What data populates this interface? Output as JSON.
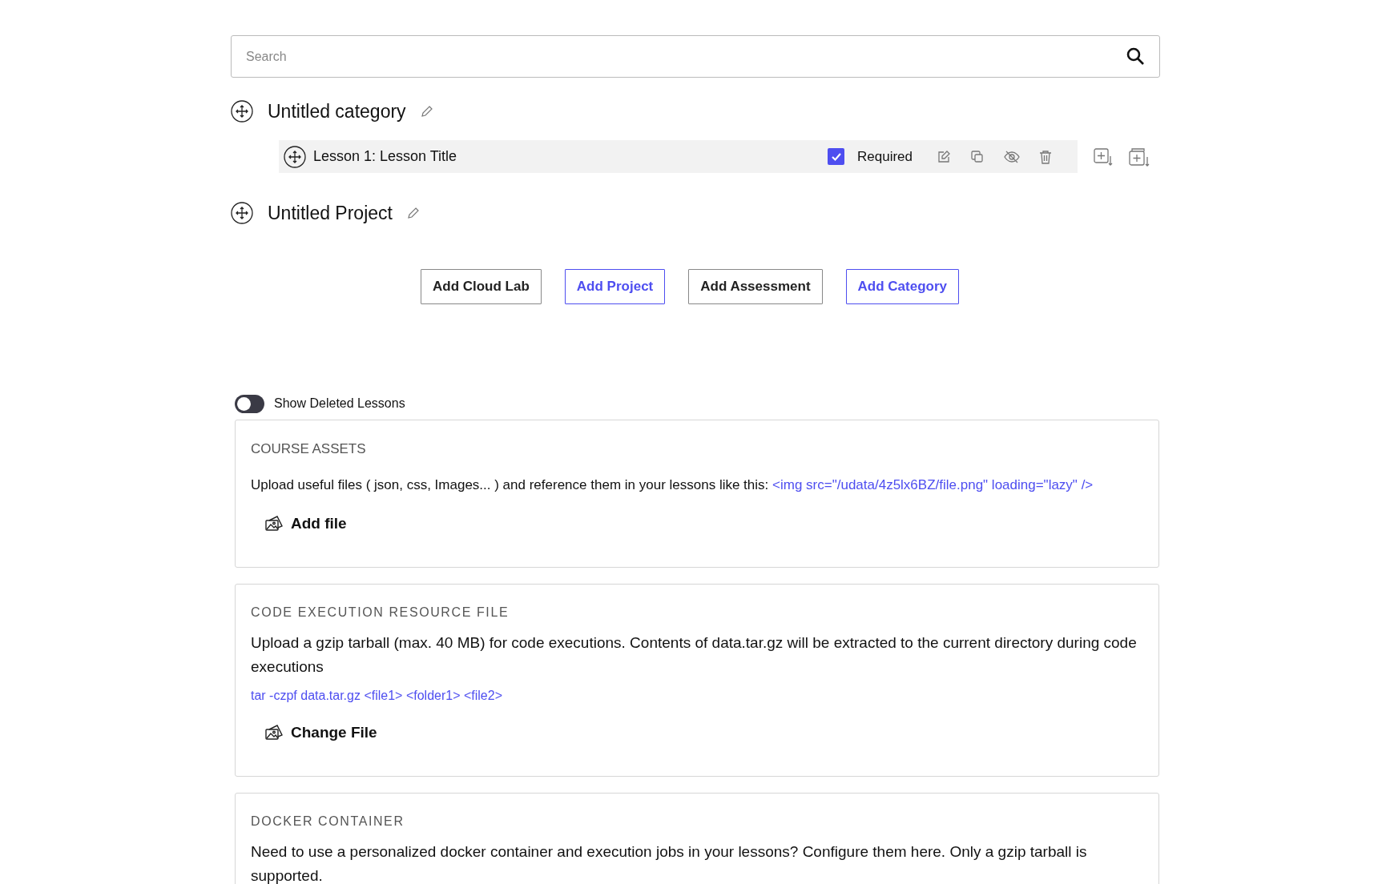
{
  "search": {
    "placeholder": "Search"
  },
  "outline": [
    {
      "title": "Untitled category",
      "children": [
        {
          "title": "Lesson 1: Lesson Title",
          "required": true,
          "required_label": "Required"
        }
      ]
    },
    {
      "title": "Untitled Project"
    }
  ],
  "buttons": [
    {
      "label": "Add Cloud Lab",
      "highlighted": false
    },
    {
      "label": "Add Project",
      "highlighted": true
    },
    {
      "label": "Add Assessment",
      "highlighted": false
    },
    {
      "label": "Add Category",
      "highlighted": true
    }
  ],
  "show_deleted": {
    "label": "Show Deleted Lessons",
    "on": false
  },
  "panels": [
    {
      "kind": "assets",
      "title": "COURSE ASSETS",
      "text": "Upload useful files ( json, css, Images... ) and reference them in your lessons like this:",
      "code": "<img src=\"/udata/4z5lx6BZ/file.png\" loading=\"lazy\" />",
      "action": "Add file"
    },
    {
      "kind": "resource",
      "title": "CODE EXECUTION RESOURCE FILE",
      "text": "Upload a gzip tarball (max. 40 MB) for code executions. Contents of data.tar.gz will be extracted to the current directory during code executions",
      "code": "tar -czpf data.tar.gz <file1> <folder1> <file2>",
      "action": "Change File"
    },
    {
      "kind": "docker",
      "title": "DOCKER CONTAINER",
      "text": "Need to use a personalized docker container and execution jobs in your lessons? Configure them here. Only a gzip tarball is supported."
    }
  ]
}
